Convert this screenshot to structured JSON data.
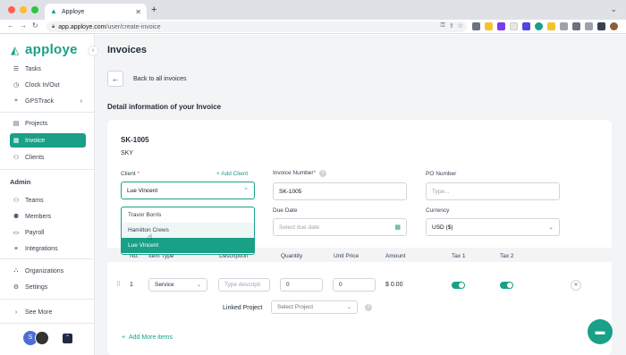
{
  "browser": {
    "tab_title": "Apploye",
    "url_host": "app.apploye.com",
    "url_path": "/user/create-invoice"
  },
  "sidebar": {
    "brand": "apploye",
    "items": [
      {
        "label": "Tasks",
        "icon": "tasks-icon"
      },
      {
        "label": "Clock In/Out",
        "icon": "clock-icon"
      },
      {
        "label": "GPSTrack",
        "icon": "gps-icon"
      },
      {
        "label": "Projects",
        "icon": "projects-icon"
      },
      {
        "label": "Invoice",
        "icon": "invoice-icon"
      },
      {
        "label": "Clients",
        "icon": "clients-icon"
      }
    ],
    "admin_title": "Admin",
    "admin_items": [
      {
        "label": "Teams"
      },
      {
        "label": "Members"
      },
      {
        "label": "Payroll"
      },
      {
        "label": "Integrations"
      },
      {
        "label": "Organizations"
      },
      {
        "label": "Settings"
      }
    ],
    "see_more": "See More",
    "avatar_initial": "S"
  },
  "main": {
    "title": "Invoices",
    "back_label": "Back to all invoices",
    "detail_heading": "Detail information of your Invoice",
    "invoice_no": "SK-1005",
    "invoice_name": "SKY",
    "client_label": "Client",
    "client_value": "Lue Vincent",
    "add_client": "+ Add Client",
    "invoice_number_label": "Invoice Number",
    "invoice_number_value": "SK-1005",
    "po_label": "PO Number",
    "po_placeholder": "Type...",
    "due_date_label": "Due Date",
    "due_date_placeholder": "Select due date",
    "currency_label": "Currency",
    "currency_value": "USD ($)",
    "client_options": [
      "Travor Borris",
      "Hamilton Crews",
      "Lue Vincent"
    ]
  },
  "table": {
    "headers": [
      "No.",
      "Item Type",
      "Description",
      "Quantity",
      "Unit Price",
      "Amount",
      "Tax 1",
      "Tax 2"
    ],
    "row": {
      "num": "1",
      "item_type": "Service",
      "description_placeholder": "Type descripti",
      "quantity": "0",
      "unit_price": "0",
      "amount": "$ 0.00",
      "tax1_on": true,
      "tax2_on": true
    },
    "linked_project_label": "Linked Project",
    "linked_project_placeholder": "Select Project",
    "add_more": "Add More items"
  },
  "colors": {
    "accent": "#19a087"
  }
}
